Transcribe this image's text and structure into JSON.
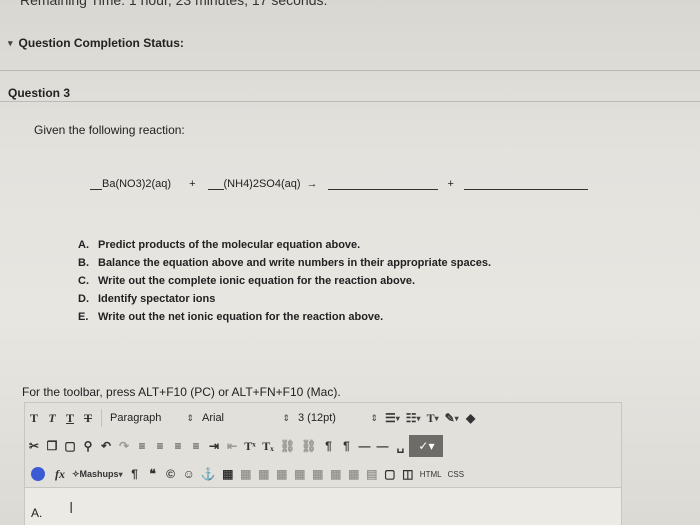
{
  "remaining_time": "Remaining Time: 1 hour, 23 minutes, 17 seconds.",
  "question_completion_status": "Question Completion Status:",
  "question_title": "Question 3",
  "given_text": "Given the following reaction:",
  "equation": {
    "reactant1": "Ba(NO3)2(aq)",
    "plus1": "+",
    "reactant2": "(NH4)2SO4(aq)",
    "arrow": "→",
    "plus2": "+"
  },
  "instructions": [
    {
      "letter": "A.",
      "text": "Predict products of the molecular equation above."
    },
    {
      "letter": "B.",
      "text": "Balance the equation above and write numbers in their appropriate spaces."
    },
    {
      "letter": "C.",
      "text": "Write out the complete ionic equation for the reaction above."
    },
    {
      "letter": "D.",
      "text": "Identify spectator ions"
    },
    {
      "letter": "E.",
      "text": "Write out the net ionic equation for the reaction above."
    }
  ],
  "toolbar_note": "For the toolbar, press ALT+F10 (PC) or ALT+FN+F10 (Mac).",
  "toolbar": {
    "paragraph": "Paragraph",
    "font": "Arial",
    "size": "3 (12pt)",
    "mashups": "Mashups",
    "html": "HTML",
    "css": "CSS"
  },
  "editor_text": "A."
}
